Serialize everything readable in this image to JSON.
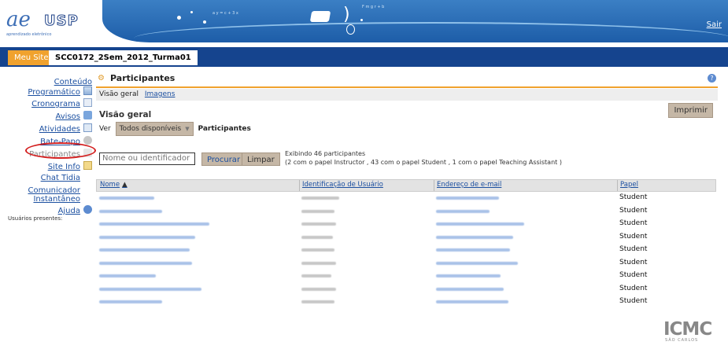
{
  "header": {
    "logo_letters": "ae",
    "logo_usp": "USP",
    "logo_tagline": "aprendizado eletrônico",
    "formula1": "a y = c + 3 x",
    "formula2": "F m g r + b",
    "logout_label": "Sair"
  },
  "tabs": {
    "my_site": "Meu Site",
    "current_site": "SCC0172_2Sem_2012_Turma01"
  },
  "nav": {
    "items": [
      {
        "label": "Conteúdo Programático",
        "icon": "document-icon"
      },
      {
        "label": "Cronograma",
        "icon": "calendar-icon"
      },
      {
        "label": "Avisos",
        "icon": "announcement-icon"
      },
      {
        "label": "Atividades",
        "icon": "tasks-icon"
      },
      {
        "label": "Bate-Papo",
        "icon": "chat-icon"
      },
      {
        "label": "Participantes",
        "icon": "people-icon"
      },
      {
        "label": "Site Info",
        "icon": "info-icon"
      },
      {
        "label": "Chat Tidia",
        "icon": ""
      },
      {
        "label": "Comunicador Instantâneo",
        "icon": ""
      },
      {
        "label": "Ajuda",
        "icon": "help-icon"
      }
    ],
    "users_present": "Usuários presentes:"
  },
  "main": {
    "title": "Participantes",
    "subnav": {
      "overview": "Visão geral",
      "images": "Imagens"
    },
    "print_label": "Imprimir",
    "section_title": "Visão geral",
    "view_label": "Ver",
    "view_selected": "Todos disponíveis",
    "view_suffix": "Participantes",
    "search_placeholder": "Nome ou identificador",
    "search_button": "Procurar",
    "clear_button": "Limpar",
    "summary_line1": "Exibindo 46 participantes",
    "summary_line2": "(2 com o papel Instructor , 43 com o papel Student , 1 com o papel Teaching Assistant )"
  },
  "table": {
    "columns": [
      "Nome",
      "Identificação de Usuário",
      "Endereço de e-mail",
      "Papel"
    ],
    "sort_indicator": "▲",
    "rows": [
      {
        "role": "Student"
      },
      {
        "role": "Student"
      },
      {
        "role": "Student"
      },
      {
        "role": "Student"
      },
      {
        "role": "Student"
      },
      {
        "role": "Student"
      },
      {
        "role": "Student"
      },
      {
        "role": "Student"
      },
      {
        "role": "Student"
      }
    ]
  },
  "footer": {
    "logo": "ICMC",
    "logo_sub": "SÃO CARLOS"
  }
}
